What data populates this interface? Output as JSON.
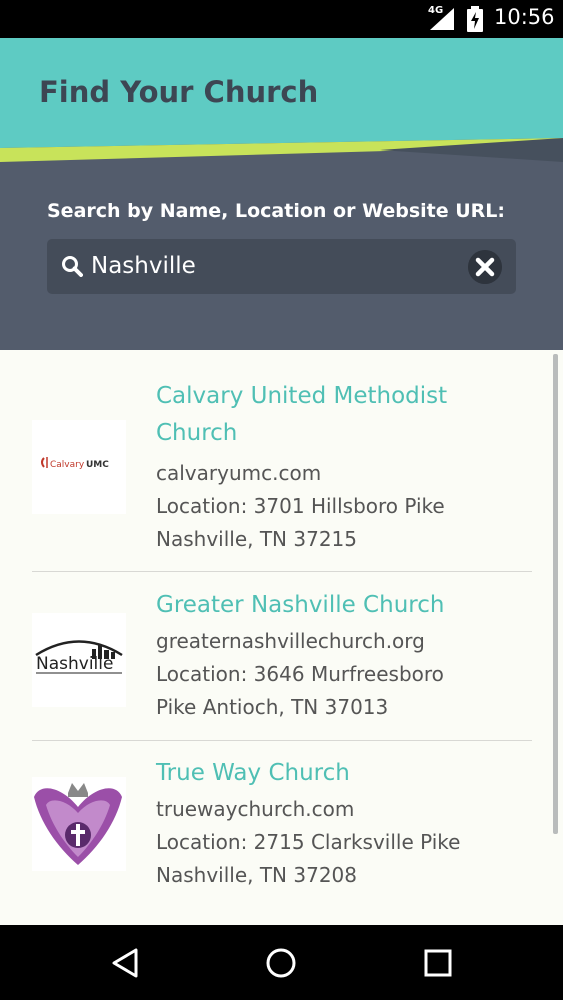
{
  "status_bar": {
    "network": "4G",
    "time": "10:56"
  },
  "header": {
    "title": "Find Your Church"
  },
  "search": {
    "label": "Search by Name, Location or Website URL:",
    "value": "Nashville"
  },
  "churches": [
    {
      "name": "Calvary United Methodist Church",
      "url": "calvaryumc.com",
      "location": "Location: 3701 Hillsboro Pike Nashville, TN 37215",
      "logo_text": "CalvaryUMC"
    },
    {
      "name": "Greater Nashville Church",
      "url": "greaternashvillechurch.org",
      "location": "Location: 3646 Murfreesboro Pike Antioch, TN 37013",
      "logo_text": "Nashville"
    },
    {
      "name": "True Way Church",
      "url": "truewaychurch.com",
      "location": "Location: 2715 Clarksville Pike Nashville, TN 37208"
    }
  ],
  "colors": {
    "teal": "#5ecbc3",
    "slate": "#535c6c",
    "accent_green": "#c8e35a",
    "link_teal": "#4fbfb4"
  },
  "icons": {
    "search": "search-icon",
    "clear": "close-circle-icon",
    "back": "back-triangle-icon",
    "home": "home-circle-icon",
    "recents": "recents-square-icon"
  }
}
